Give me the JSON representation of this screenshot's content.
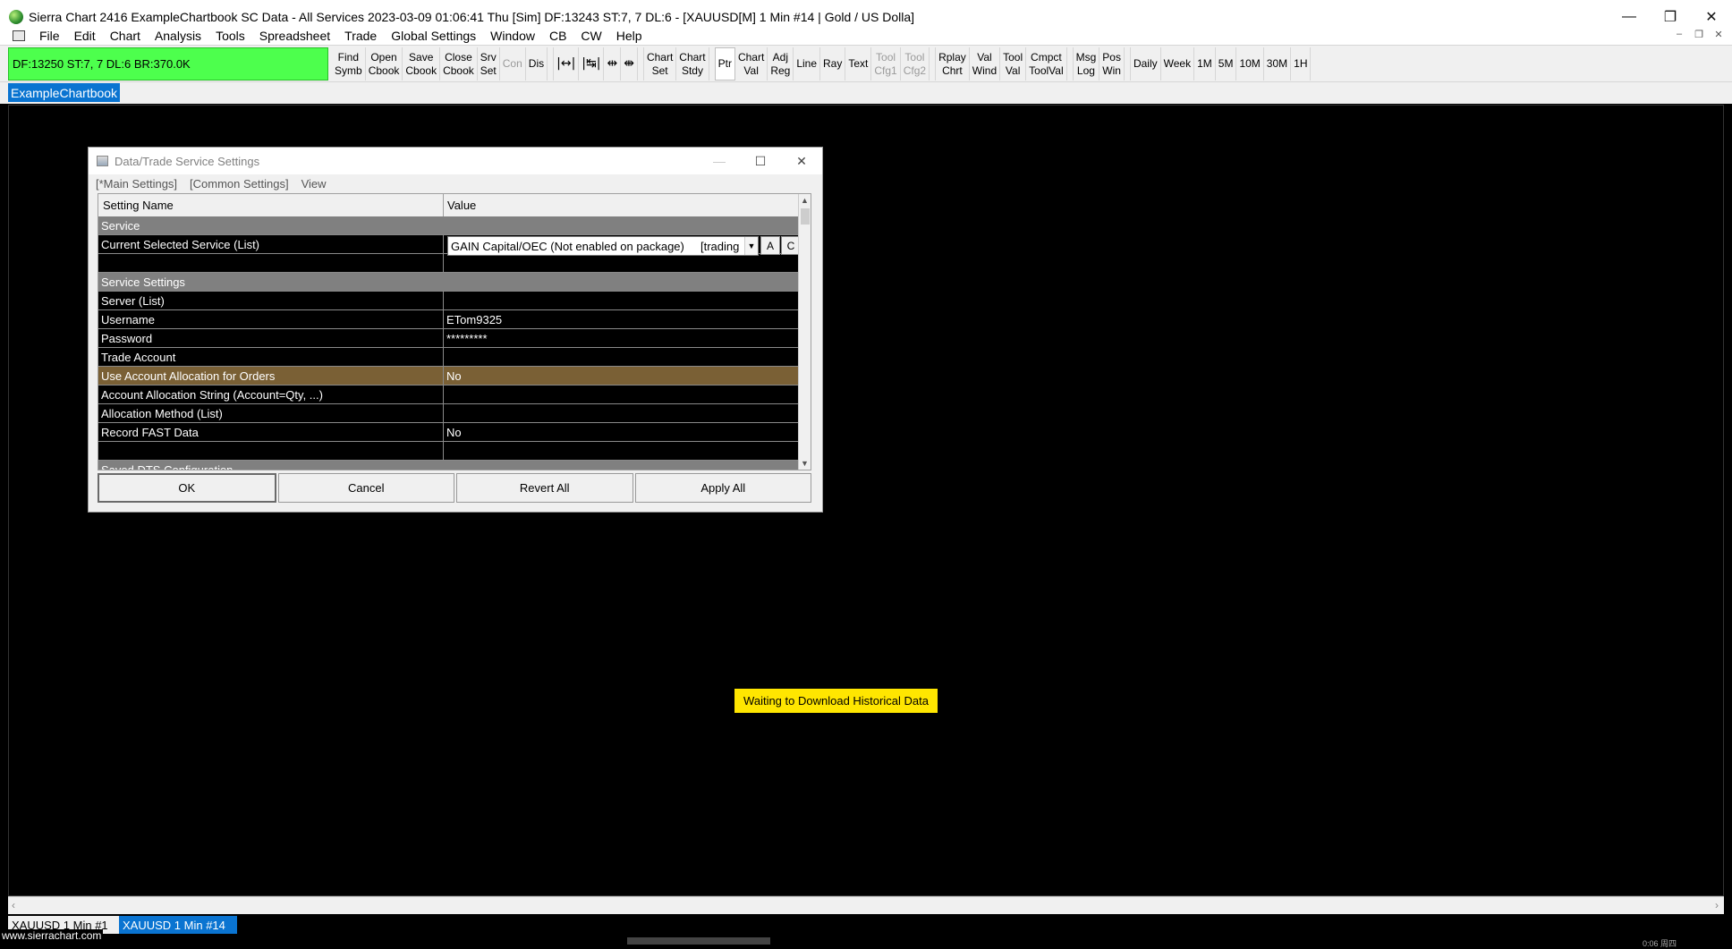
{
  "window": {
    "title": "Sierra Chart 2416 ExampleChartbook  SC Data - All Services 2023-03-09  01:06:41 Thu [Sim]  DF:13243  ST:7, 7  DL:6 - [XAUUSD[M]  1 Min   #14 | Gold / US Dolla]",
    "minimize": "—",
    "restore": "❐",
    "close": "✕"
  },
  "menu": {
    "items": [
      "File",
      "Edit",
      "Chart",
      "Analysis",
      "Tools",
      "Spreadsheet",
      "Trade",
      "Global Settings",
      "Window",
      "CB",
      "CW",
      "Help"
    ],
    "mdi": [
      "–",
      "❐",
      "✕"
    ]
  },
  "toolbar": {
    "status": "DF:13250  ST:7, 7  DL:6  BR:370.0K",
    "buttons": [
      {
        "l1": "Find",
        "l2": "Symb"
      },
      {
        "l1": "Open",
        "l2": "Cbook"
      },
      {
        "l1": "Save",
        "l2": "Cbook"
      },
      {
        "l1": "Close",
        "l2": "Cbook"
      },
      {
        "l1": "Srv",
        "l2": "Set"
      },
      {
        "l1": "Con",
        "l2": ""
      },
      {
        "l1": "Dis",
        "l2": ""
      },
      {
        "icon": "|↔|"
      },
      {
        "icon": "|↹|"
      },
      {
        "icon": "⇹"
      },
      {
        "icon": "⇼"
      },
      {
        "l1": "Chart",
        "l2": "Set"
      },
      {
        "l1": "Chart",
        "l2": "Stdy"
      },
      {
        "l1": "Ptr",
        "l2": ""
      },
      {
        "l1": "Chart",
        "l2": "Val"
      },
      {
        "l1": "Adj",
        "l2": "Reg"
      },
      {
        "l1": "Line",
        "l2": ""
      },
      {
        "l1": "Ray",
        "l2": ""
      },
      {
        "l1": "Text",
        "l2": ""
      },
      {
        "l1": "Tool",
        "l2": "Cfg1"
      },
      {
        "l1": "Tool",
        "l2": "Cfg2"
      },
      {
        "l1": "Rplay",
        "l2": "Chrt"
      },
      {
        "l1": "Val",
        "l2": "Wind"
      },
      {
        "l1": "Tool",
        "l2": "Val"
      },
      {
        "l1": "Cmpct",
        "l2": "ToolVal"
      },
      {
        "l1": "Msg",
        "l2": "Log"
      },
      {
        "l1": "Pos",
        "l2": "Win"
      },
      {
        "l1": "Daily",
        "l2": ""
      },
      {
        "l1": "Week",
        "l2": ""
      },
      {
        "l1": "1M",
        "l2": ""
      },
      {
        "l1": "5M",
        "l2": ""
      },
      {
        "l1": "10M",
        "l2": ""
      },
      {
        "l1": "30M",
        "l2": ""
      },
      {
        "l1": "1H",
        "l2": ""
      }
    ]
  },
  "chartbook_tab": "ExampleChartbook",
  "chart": {
    "waiting_message": "Waiting to Download Historical Data"
  },
  "chart_tabs": {
    "inactive": "XAUUSD  1 Min   #1",
    "active": "XAUUSD  1 Min   #14"
  },
  "footer": {
    "website": "www.sierrachart.com",
    "time": "0:06 周四"
  },
  "dialog": {
    "title": "Data/Trade Service Settings",
    "tabs": [
      "[*Main Settings]",
      "[Common Settings]",
      "View"
    ],
    "col_name": "Setting Name",
    "col_value": "Value",
    "sections": {
      "service": "Service",
      "service_settings": "Service Settings",
      "saved": "Saved DTS Configuration"
    },
    "rows": {
      "current_service": {
        "name": "Current Selected Service (List)",
        "value": "GAIN Capital/OEC (Not enabled on package)",
        "extra": "[trading"
      },
      "server": {
        "name": "Server (List)",
        "value": ""
      },
      "username": {
        "name": "Username",
        "value": "ETom9325"
      },
      "password": {
        "name": "Password",
        "value": "*********"
      },
      "trade_account": {
        "name": "Trade Account",
        "value": ""
      },
      "use_alloc": {
        "name": "Use Account Allocation for Orders",
        "value": "No"
      },
      "alloc_string": {
        "name": "Account Allocation String (Account=Qty, ...)",
        "value": ""
      },
      "alloc_method": {
        "name": "Allocation Method (List)",
        "value": ""
      },
      "record_fast": {
        "name": "Record FAST Data",
        "value": "No"
      }
    },
    "btn_a": "A",
    "btn_c": "C",
    "buttons": {
      "ok": "OK",
      "cancel": "Cancel",
      "revert": "Revert All",
      "apply": "Apply All"
    }
  }
}
